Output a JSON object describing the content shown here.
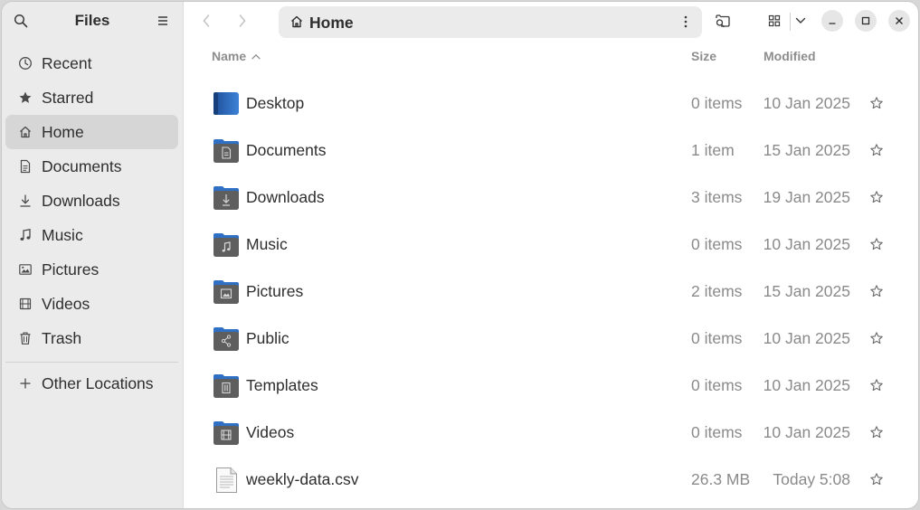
{
  "sidebar": {
    "title": "Files",
    "items": [
      {
        "label": "Recent",
        "icon": "clock-icon",
        "active": false
      },
      {
        "label": "Starred",
        "icon": "star-icon",
        "active": false
      },
      {
        "label": "Home",
        "icon": "home-icon",
        "active": true
      },
      {
        "label": "Documents",
        "icon": "document-icon",
        "active": false
      },
      {
        "label": "Downloads",
        "icon": "download-icon",
        "active": false
      },
      {
        "label": "Music",
        "icon": "music-icon",
        "active": false
      },
      {
        "label": "Pictures",
        "icon": "picture-icon",
        "active": false
      },
      {
        "label": "Videos",
        "icon": "film-icon",
        "active": false
      },
      {
        "label": "Trash",
        "icon": "trash-icon",
        "active": false
      }
    ],
    "other_locations": "Other Locations"
  },
  "header": {
    "path_label": "Home"
  },
  "columns": {
    "name": "Name",
    "size": "Size",
    "modified": "Modified"
  },
  "files": [
    {
      "name": "Desktop",
      "size": "0 items",
      "modified": "10 Jan 2025",
      "icon": "desktop-folder-icon"
    },
    {
      "name": "Documents",
      "size": "1 item",
      "modified": "15 Jan 2025",
      "icon": "documents-folder-icon"
    },
    {
      "name": "Downloads",
      "size": "3 items",
      "modified": "19 Jan 2025",
      "icon": "downloads-folder-icon"
    },
    {
      "name": "Music",
      "size": "0 items",
      "modified": "10 Jan 2025",
      "icon": "music-folder-icon"
    },
    {
      "name": "Pictures",
      "size": "2 items",
      "modified": "15 Jan 2025",
      "icon": "pictures-folder-icon"
    },
    {
      "name": "Public",
      "size": "0 items",
      "modified": "10 Jan 2025",
      "icon": "public-folder-icon"
    },
    {
      "name": "Templates",
      "size": "0 items",
      "modified": "10 Jan 2025",
      "icon": "templates-folder-icon"
    },
    {
      "name": "Videos",
      "size": "0 items",
      "modified": "10 Jan 2025",
      "icon": "videos-folder-icon"
    },
    {
      "name": "weekly-data.csv",
      "size": "26.3 MB",
      "modified": "Today 5:08",
      "icon": "text-file-icon"
    }
  ],
  "colors": {
    "folder_blue": "#2f6fc4",
    "folder_gray": "#5e5e5e",
    "sidebar_bg": "#ebebeb",
    "sidebar_active": "#d6d6d6"
  }
}
